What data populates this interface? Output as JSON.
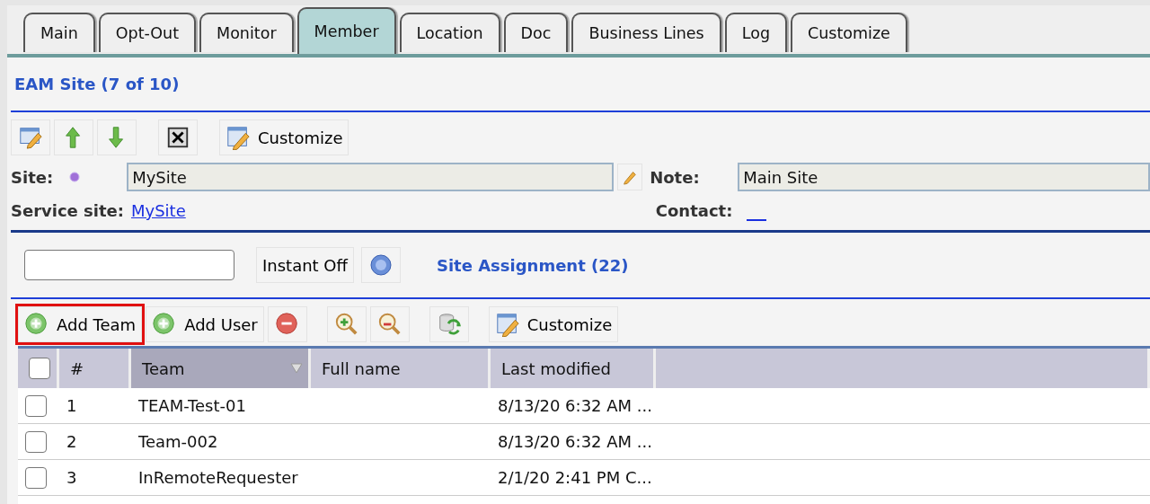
{
  "tabs": [
    {
      "label": "Main",
      "selected": false
    },
    {
      "label": "Opt-Out",
      "selected": false
    },
    {
      "label": "Monitor",
      "selected": false
    },
    {
      "label": "Member",
      "selected": true
    },
    {
      "label": "Location",
      "selected": false
    },
    {
      "label": "Doc",
      "selected": false
    },
    {
      "label": "Business Lines",
      "selected": false
    },
    {
      "label": "Log",
      "selected": false
    },
    {
      "label": "Customize",
      "selected": false
    }
  ],
  "record": {
    "title": "EAM Site (7 of 10)",
    "toolbar": [
      {
        "kind": "edit"
      },
      {
        "kind": "up"
      },
      {
        "kind": "down"
      },
      {
        "kind": "close"
      },
      {
        "kind": "customize",
        "label": "Customize"
      }
    ],
    "site_label": "Site:",
    "site_value": "MySite",
    "note_label": "Note:",
    "note_value": "Main Site",
    "service_site_label": "Service site:",
    "service_site_link": "MySite",
    "contact_label": "Contact:"
  },
  "assignment": {
    "select_all": {
      "checked": false
    },
    "instant_button": "Instant Off",
    "title": "Site Assignment (22)",
    "toolbar": [
      {
        "kind": "add",
        "label": "Add Team",
        "highlighted": true
      },
      {
        "kind": "add",
        "label": "Add User",
        "highlighted": false
      },
      {
        "kind": "remove",
        "highlighted": false
      },
      {
        "kind": "zoom-in",
        "highlighted": false
      },
      {
        "kind": "zoom-out",
        "highlighted": false
      },
      {
        "kind": "refresh",
        "highlighted": false
      },
      {
        "kind": "customize",
        "label": "Customize",
        "highlighted": false
      }
    ],
    "columns": [
      {
        "label": "#",
        "sorted": false
      },
      {
        "label": "Team",
        "sorted": true
      },
      {
        "label": "Full name",
        "sorted": false
      },
      {
        "label": "Last modified",
        "sorted": false
      }
    ],
    "rows": [
      {
        "checked": false,
        "number": "1",
        "team": "TEAM-Test-01",
        "modified": "8/13/20 6:32 AM ..."
      },
      {
        "checked": false,
        "number": "2",
        "team": "Team-002",
        "modified": "8/13/20 6:32 AM ..."
      },
      {
        "checked": false,
        "number": "3",
        "team": "InRemoteRequester",
        "modified": "2/1/20 2:41 PM C..."
      }
    ]
  }
}
